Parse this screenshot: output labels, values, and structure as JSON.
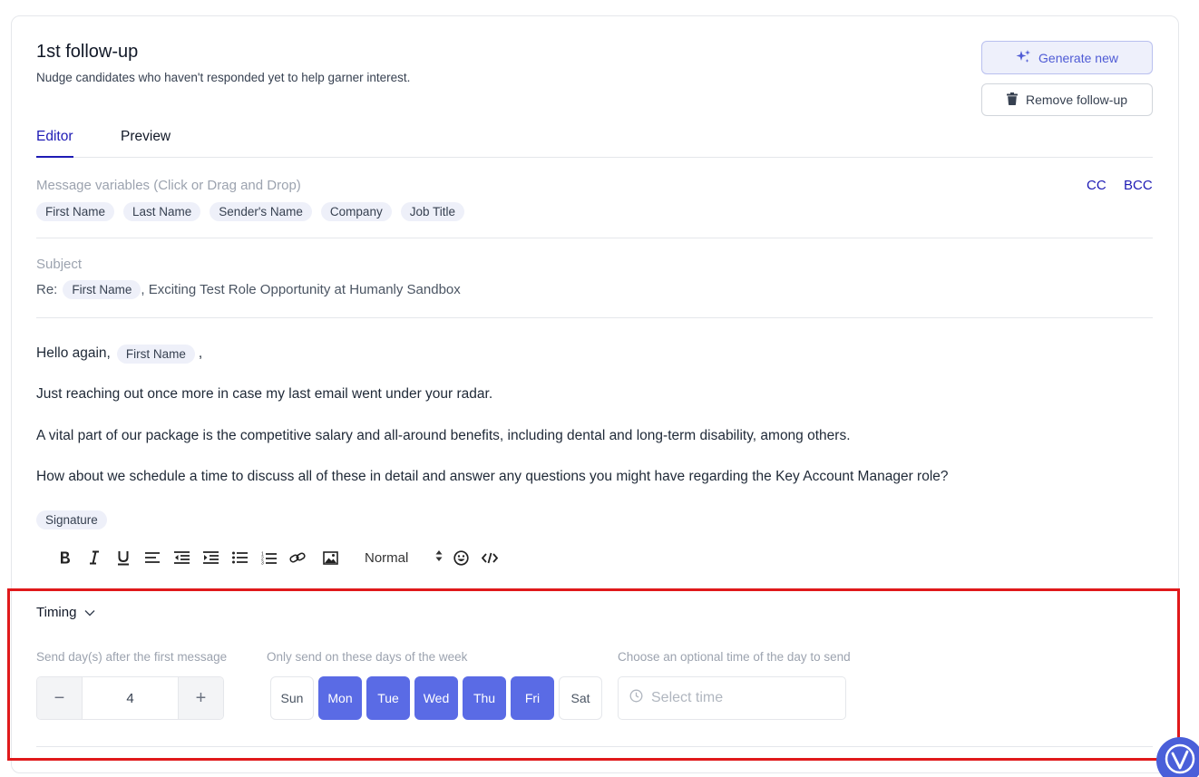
{
  "header": {
    "title": "1st follow-up",
    "subtitle": "Nudge candidates who haven't responded yet to help garner interest.",
    "generate_label": "Generate new",
    "remove_label": "Remove follow-up"
  },
  "tabs": [
    {
      "label": "Editor",
      "active": true
    },
    {
      "label": "Preview",
      "active": false
    }
  ],
  "variables": {
    "label": "Message variables (Click or Drag and Drop)",
    "chips": [
      "First Name",
      "Last Name",
      "Sender's Name",
      "Company",
      "Job Title"
    ],
    "cc_label": "CC",
    "bcc_label": "BCC"
  },
  "subject": {
    "label": "Subject",
    "prefix": "Re:",
    "chip": "First Name",
    "suffix": ", Exciting Test Role Opportunity at Humanly Sandbox"
  },
  "message": {
    "greeting_prefix": "Hello again,",
    "greeting_chip": "First Name",
    "greeting_suffix": ",",
    "paragraphs": [
      "Just reaching out once more in case my last email went under your radar.",
      "A vital part of our package is the competitive salary and all-around benefits, including dental and long-term disability, among others.",
      "How about we schedule a time to discuss all of these in detail and answer any questions you might have regarding the Key Account Manager role?"
    ],
    "signature_chip": "Signature"
  },
  "toolbar": {
    "heading_value": "Normal",
    "icons": [
      "bold-icon",
      "italic-icon",
      "underline-icon",
      "align-icon",
      "outdent-icon",
      "indent-icon",
      "bullet-list-icon",
      "ordered-list-icon",
      "link-icon",
      "image-icon",
      "emoji-icon",
      "code-icon"
    ]
  },
  "timing": {
    "toggle_label": "Timing",
    "days_after_label": "Send day(s) after the first message",
    "days_after_value": "4",
    "decrement_symbol": "−",
    "increment_symbol": "+",
    "weekdays_label": "Only send on these days of the week",
    "weekdays": [
      {
        "label": "Sun",
        "selected": false
      },
      {
        "label": "Mon",
        "selected": true
      },
      {
        "label": "Tue",
        "selected": true
      },
      {
        "label": "Wed",
        "selected": true
      },
      {
        "label": "Thu",
        "selected": true
      },
      {
        "label": "Fri",
        "selected": true
      },
      {
        "label": "Sat",
        "selected": false
      }
    ],
    "time_label": "Choose an optional time of the day to send",
    "time_placeholder": "Select time"
  },
  "colors": {
    "accent": "#1e1bb5",
    "day_selected": "#5a6be5",
    "highlight_box": "#e0191b"
  }
}
